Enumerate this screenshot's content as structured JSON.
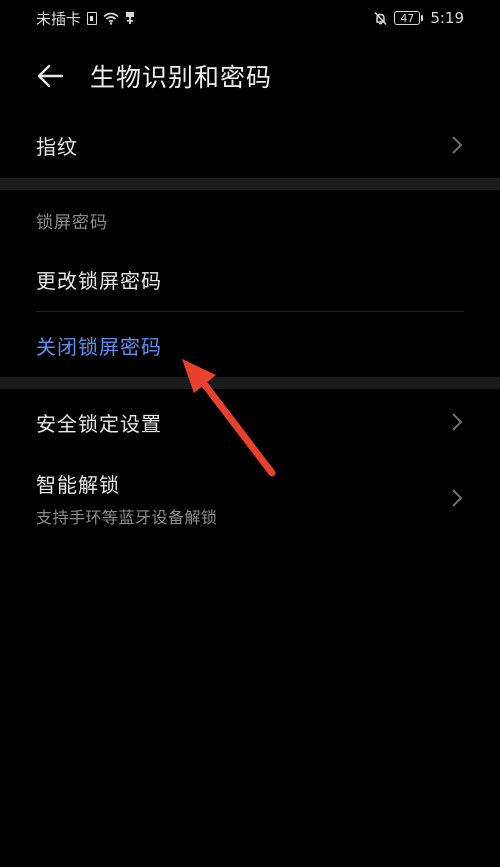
{
  "status_bar": {
    "carrier": "未插卡",
    "battery_level": "47",
    "time": "5:19"
  },
  "header": {
    "title": "生物识别和密码"
  },
  "items": {
    "fingerprint": {
      "label": "指纹"
    },
    "lock_section_header": "锁屏密码",
    "change_password": {
      "label": "更改锁屏密码"
    },
    "disable_password": {
      "label": "关闭锁屏密码"
    },
    "secure_lock": {
      "label": "安全锁定设置"
    },
    "smart_unlock": {
      "label": "智能解锁",
      "subtitle": "支持手环等蓝牙设备解锁"
    }
  },
  "colors": {
    "background": "#000000",
    "accent": "#5b8ff0",
    "annotation_arrow": "#e8412c",
    "section_gap": "#1b1b1b"
  }
}
